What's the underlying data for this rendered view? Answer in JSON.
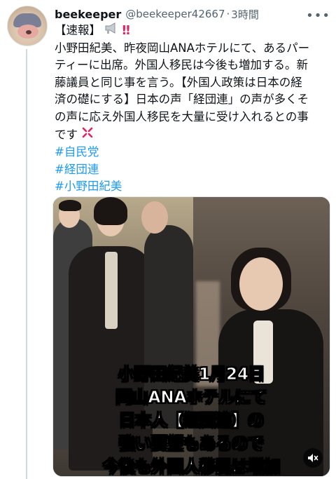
{
  "user": {
    "name": "beekeeper",
    "handle": "@beekeeper42667",
    "dot": "·",
    "time": "3時間"
  },
  "more_icon": "more-horizontal-icon",
  "tweet": {
    "lines": [
      "【速報】",
      "小野田紀美、昨夜岡山ANAホテルにて、あるパー",
      "ティーに出席。外国人移民は今後も増加する。新",
      "藤議員と同じ事を言う。【外国人政策は日本の経",
      "済の礎にする】日本の声「経団連」の声が多くそ",
      "の声に応え外国人移民を大量に受け入れるとの事",
      "です"
    ],
    "hashtags": [
      "#自民党",
      "#経団連",
      "#小野田紀美"
    ]
  },
  "media": {
    "caption_lines": [
      "小野田紀美1月24日",
      "岡山ANAホテルにて",
      "日本人【経団連】の",
      "強い要望もあるので",
      "今後も外国人移民は増加"
    ],
    "mute_icon": "volume-muted-icon"
  },
  "colors": {
    "hashtag": "#1d9bf0",
    "secondary_text": "#536471",
    "alert_red": "#e0245e"
  }
}
